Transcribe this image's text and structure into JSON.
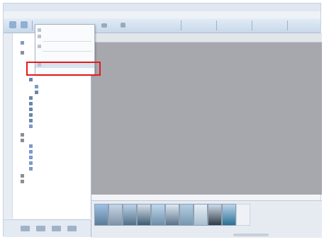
{
  "window": {
    "title": ""
  },
  "menu": {
    "items": [
      {
        "label": ""
      },
      {
        "label": ""
      },
      {
        "label": ""
      },
      {
        "label": ""
      },
      {
        "label": ""
      },
      {
        "label": ""
      }
    ]
  },
  "dropdown": {
    "items": [
      {
        "label": "",
        "shortcut": ""
      },
      {
        "label": "",
        "shortcut": ""
      },
      {
        "label": "",
        "shortcut": ""
      },
      {
        "label": "",
        "shortcut": ""
      },
      {
        "label": "",
        "shortcut": ""
      }
    ]
  },
  "tree": {
    "nodes": []
  },
  "thumbnails": {
    "count_visible": 11
  },
  "colors": {
    "highlight": "#e41b1b",
    "toolbar": "#c8d8ea",
    "viewer_bg": "#a6a8ad"
  }
}
